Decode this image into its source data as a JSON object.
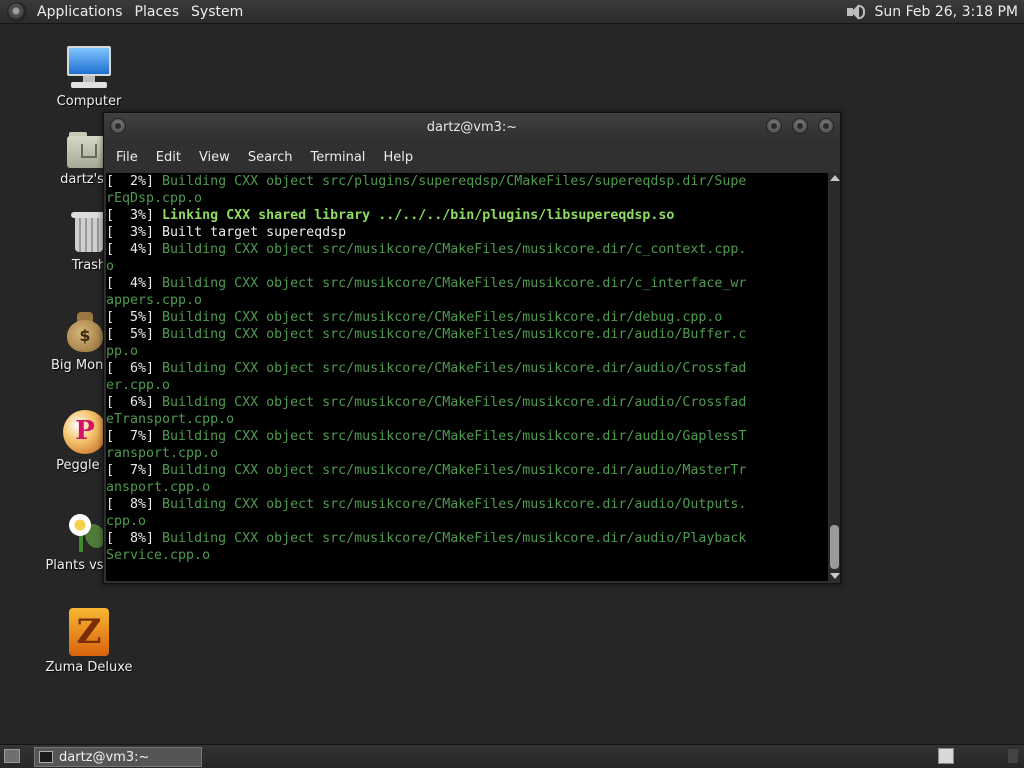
{
  "top_panel": {
    "menus": [
      "Applications",
      "Places",
      "System"
    ],
    "clock": "Sun Feb 26,  3:18 PM",
    "icons": {
      "main": "gnome-foot-icon",
      "volume": "speaker-volume-icon"
    }
  },
  "desktop": {
    "icons": [
      {
        "label": "Computer",
        "icon": "computer-icon"
      },
      {
        "label": "dartz's H",
        "icon": "home-folder-icon"
      },
      {
        "label": "Trash",
        "icon": "trash-icon"
      },
      {
        "label": "Big Money",
        "icon": "money-bag-icon"
      },
      {
        "label": "Peggle D",
        "icon": "peggle-icon"
      },
      {
        "label": "Plants vs Zo",
        "icon": "plants-icon"
      },
      {
        "label": "Zuma Deluxe",
        "icon": "zuma-icon"
      }
    ]
  },
  "terminal": {
    "title": "dartz@vm3:~",
    "menu": [
      "File",
      "Edit",
      "View",
      "Search",
      "Terminal",
      "Help"
    ],
    "lines": [
      {
        "p": "[  2%] ",
        "t": "Building CXX object src/plugins/supereqdsp/CMakeFiles/supereqdsp.dir/Supe",
        "s": "g"
      },
      {
        "p": "",
        "t": "rEqDsp.cpp.o",
        "s": "g"
      },
      {
        "p": "[  3%] ",
        "t": "Linking CXX shared library ../../../bin/plugins/libsupereqdsp.so",
        "s": "bg"
      },
      {
        "p": "[  3%] ",
        "t": "Built target supereqdsp",
        "s": "w"
      },
      {
        "p": "[  4%] ",
        "t": "Building CXX object src/musikcore/CMakeFiles/musikcore.dir/c_context.cpp.",
        "s": "g"
      },
      {
        "p": "",
        "t": "o",
        "s": "g"
      },
      {
        "p": "[  4%] ",
        "t": "Building CXX object src/musikcore/CMakeFiles/musikcore.dir/c_interface_wr",
        "s": "g"
      },
      {
        "p": "",
        "t": "appers.cpp.o",
        "s": "g"
      },
      {
        "p": "[  5%] ",
        "t": "Building CXX object src/musikcore/CMakeFiles/musikcore.dir/debug.cpp.o",
        "s": "g"
      },
      {
        "p": "[  5%] ",
        "t": "Building CXX object src/musikcore/CMakeFiles/musikcore.dir/audio/Buffer.c",
        "s": "g"
      },
      {
        "p": "",
        "t": "pp.o",
        "s": "g"
      },
      {
        "p": "[  6%] ",
        "t": "Building CXX object src/musikcore/CMakeFiles/musikcore.dir/audio/Crossfad",
        "s": "g"
      },
      {
        "p": "",
        "t": "er.cpp.o",
        "s": "g"
      },
      {
        "p": "[  6%] ",
        "t": "Building CXX object src/musikcore/CMakeFiles/musikcore.dir/audio/Crossfad",
        "s": "g"
      },
      {
        "p": "",
        "t": "eTransport.cpp.o",
        "s": "g"
      },
      {
        "p": "[  7%] ",
        "t": "Building CXX object src/musikcore/CMakeFiles/musikcore.dir/audio/GaplessT",
        "s": "g"
      },
      {
        "p": "",
        "t": "ransport.cpp.o",
        "s": "g"
      },
      {
        "p": "[  7%] ",
        "t": "Building CXX object src/musikcore/CMakeFiles/musikcore.dir/audio/MasterTr",
        "s": "g"
      },
      {
        "p": "",
        "t": "ansport.cpp.o",
        "s": "g"
      },
      {
        "p": "[  8%] ",
        "t": "Building CXX object src/musikcore/CMakeFiles/musikcore.dir/audio/Outputs.",
        "s": "g"
      },
      {
        "p": "",
        "t": "cpp.o",
        "s": "g"
      },
      {
        "p": "[  8%] ",
        "t": "Building CXX object src/musikcore/CMakeFiles/musikcore.dir/audio/Playback",
        "s": "g"
      },
      {
        "p": "",
        "t": "Service.cpp.o",
        "s": "g"
      }
    ]
  },
  "bottom_panel": {
    "task_label": "dartz@vm3:~"
  }
}
